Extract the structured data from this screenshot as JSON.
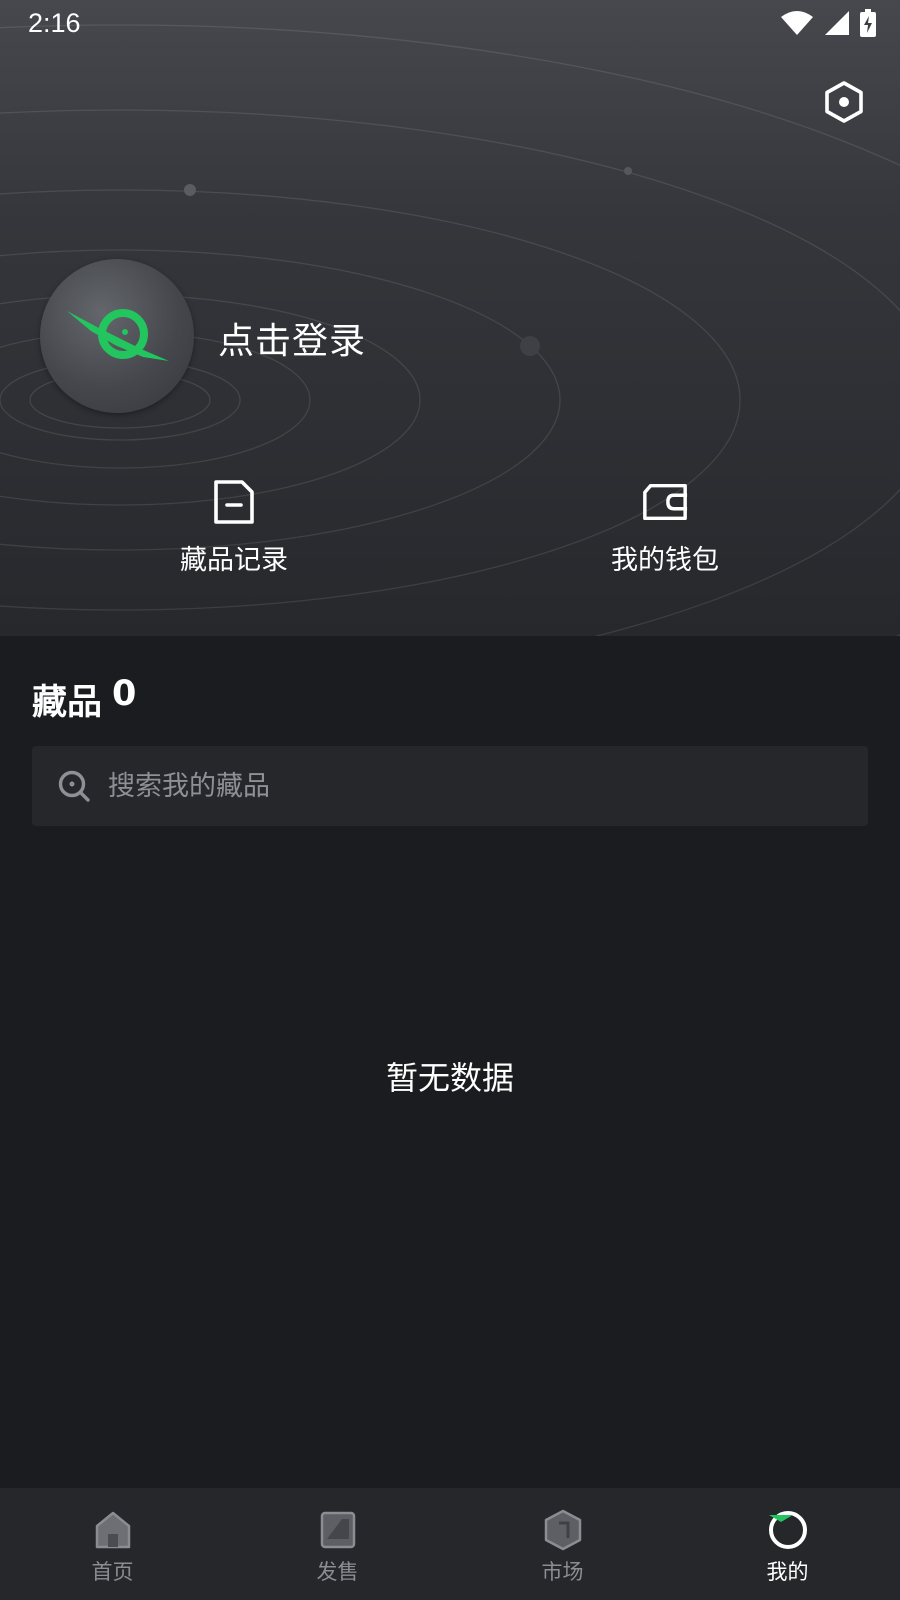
{
  "status_bar": {
    "time": "2:16",
    "icons": [
      "wifi-icon",
      "signal-icon",
      "battery-charging-icon"
    ]
  },
  "header": {
    "settings_icon": "settings-hexagon-icon",
    "login_text": "点击登录",
    "quick_actions": [
      {
        "label": "藏品记录",
        "icon": "record-document-icon"
      },
      {
        "label": "我的钱包",
        "icon": "wallet-icon"
      }
    ]
  },
  "collection": {
    "title": "藏品",
    "count": "0",
    "search_placeholder": "搜索我的藏品",
    "search_value": "",
    "empty_text": "暂无数据"
  },
  "bottom_nav": {
    "items": [
      {
        "label": "首页",
        "icon": "home-icon",
        "active": false
      },
      {
        "label": "发售",
        "icon": "sale-icon",
        "active": false
      },
      {
        "label": "市场",
        "icon": "market-cube-icon",
        "active": false
      },
      {
        "label": "我的",
        "icon": "profile-planet-icon",
        "active": true
      }
    ]
  },
  "colors": {
    "accent_green": "#22c55e",
    "background": "#1b1c1f",
    "card": "#25272b",
    "inactive_text": "#8b8d92"
  }
}
